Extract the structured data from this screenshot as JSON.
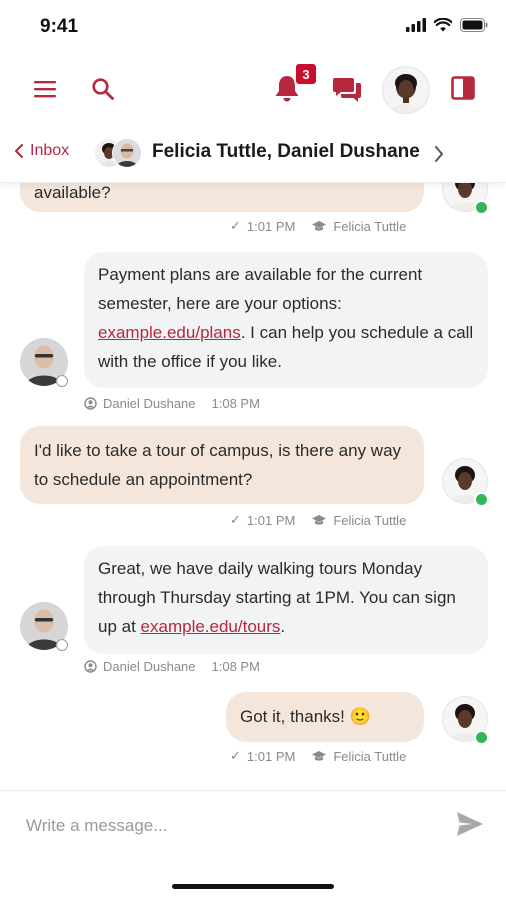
{
  "status": {
    "time": "9:41"
  },
  "toolbar": {
    "notification_count": "3"
  },
  "header": {
    "back_label": "Inbox",
    "title": "Felicia Tuttle, Daniel Dushane"
  },
  "messages": [
    {
      "side": "out",
      "lines": [
        "available?"
      ],
      "time": "1:01 PM",
      "author": "Felicia Tuttle"
    },
    {
      "side": "in",
      "text_a": "Payment plans are available for the current semester, here are your options:",
      "link": "example.edu/plans",
      "text_b": ". I can help you schedule a call with the office if you like.",
      "author": "Daniel Dushane",
      "time": "1:08 PM"
    },
    {
      "side": "out",
      "text": "I'd like to take a tour of campus, is there any way to schedule an appointment?",
      "time": "1:01 PM",
      "author": "Felicia Tuttle"
    },
    {
      "side": "in",
      "text_a": "Great, we have daily walking tours Monday through Thursday starting at 1PM. You can sign up at ",
      "link": "example.edu/tours",
      "text_b": ".",
      "author": "Daniel Dushane",
      "time": "1:08 PM"
    },
    {
      "side": "out",
      "text": "Got it, thanks! 🙂",
      "time": "1:01 PM",
      "author": "Felicia Tuttle"
    }
  ],
  "composer": {
    "placeholder": "Write a message..."
  },
  "colors": {
    "brand": "#b5283e",
    "bubble_out": "#f4e6da",
    "bubble_in": "#f2f3f5",
    "online": "#31b65a"
  }
}
